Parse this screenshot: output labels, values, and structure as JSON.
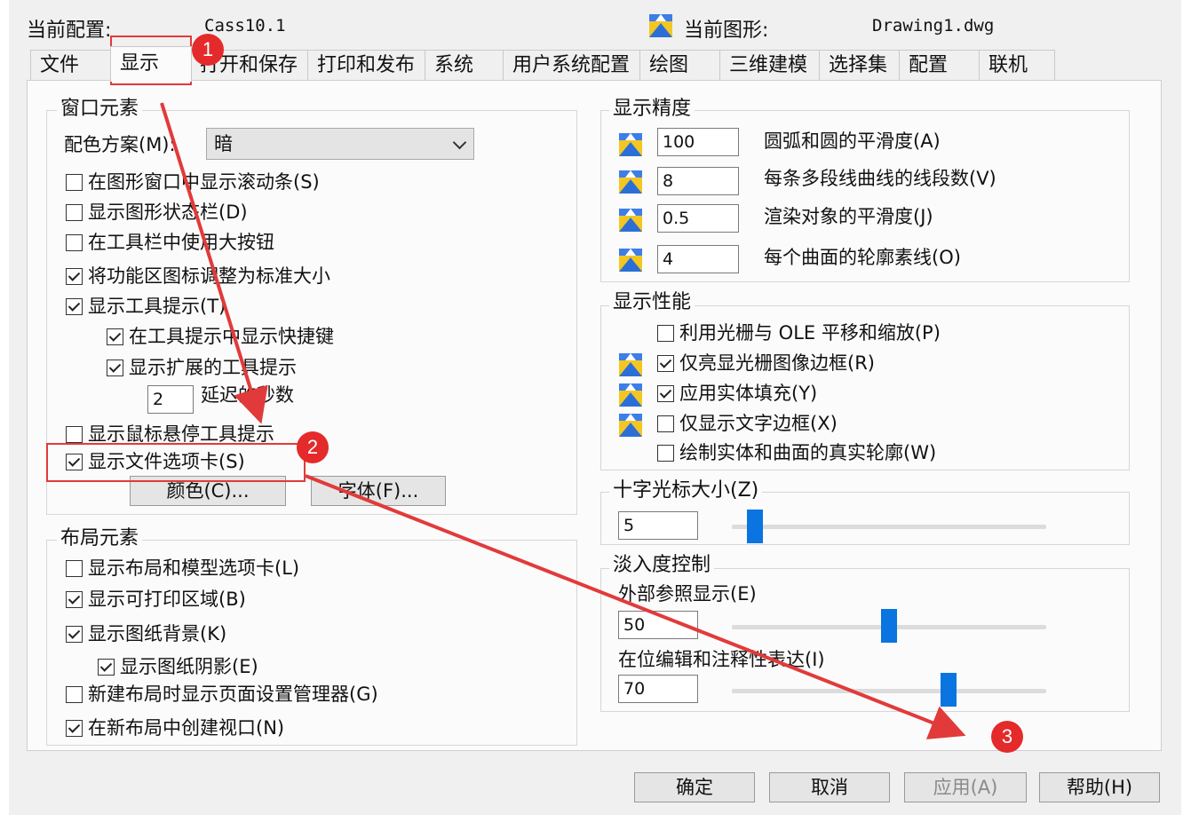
{
  "header": {
    "current_profile_label": "当前配置:",
    "current_profile_value": "Cass10.1",
    "current_drawing_label": "当前图形:",
    "current_drawing_value": "Drawing1.dwg"
  },
  "tabs": [
    {
      "label": "文件"
    },
    {
      "label": "显示",
      "active": true
    },
    {
      "label": "打开和保存"
    },
    {
      "label": "打印和发布"
    },
    {
      "label": "系统"
    },
    {
      "label": "用户系统配置"
    },
    {
      "label": "绘图"
    },
    {
      "label": "三维建模"
    },
    {
      "label": "选择集"
    },
    {
      "label": "配置"
    },
    {
      "label": "联机"
    }
  ],
  "window_elements": {
    "title": "窗口元素",
    "color_scheme_label": "配色方案(M):",
    "color_scheme_value": "暗",
    "checkboxes": [
      {
        "label": "在图形窗口中显示滚动条(S)",
        "checked": false
      },
      {
        "label": "显示图形状态栏(D)",
        "checked": false
      },
      {
        "label": "在工具栏中使用大按钮",
        "checked": false
      },
      {
        "label": "将功能区图标调整为标准大小",
        "checked": true
      },
      {
        "label": "显示工具提示(T)",
        "checked": true
      },
      {
        "label": "在工具提示中显示快捷键",
        "checked": true
      },
      {
        "label": "显示扩展的工具提示",
        "checked": true
      },
      {
        "label": "显示鼠标悬停工具提示",
        "checked": false
      },
      {
        "label": "显示文件选项卡(S)",
        "checked": true
      }
    ],
    "delay_value": "2",
    "delay_label": "延迟的秒数",
    "colors_button": "颜色(C)...",
    "fonts_button": "字体(F)..."
  },
  "layout_elements": {
    "title": "布局元素",
    "checkboxes": [
      {
        "label": "显示布局和模型选项卡(L)",
        "checked": false
      },
      {
        "label": "显示可打印区域(B)",
        "checked": true
      },
      {
        "label": "显示图纸背景(K)",
        "checked": true
      },
      {
        "label": "显示图纸阴影(E)",
        "checked": true
      },
      {
        "label": "新建布局时显示页面设置管理器(G)",
        "checked": false
      },
      {
        "label": "在新布局中创建视口(N)",
        "checked": true
      }
    ]
  },
  "display_resolution": {
    "title": "显示精度",
    "rows": [
      {
        "value": "100",
        "label": "圆弧和圆的平滑度(A)"
      },
      {
        "value": "8",
        "label": "每条多段线曲线的线段数(V)"
      },
      {
        "value": "0.5",
        "label": "渲染对象的平滑度(J)"
      },
      {
        "value": "4",
        "label": "每个曲面的轮廓素线(O)"
      }
    ]
  },
  "display_performance": {
    "title": "显示性能",
    "checkboxes": [
      {
        "label": "利用光栅与 OLE 平移和缩放(P)",
        "checked": false
      },
      {
        "label": "仅亮显光栅图像边框(R)",
        "checked": true
      },
      {
        "label": "应用实体填充(Y)",
        "checked": true
      },
      {
        "label": "仅显示文字边框(X)",
        "checked": false
      },
      {
        "label": "绘制实体和曲面的真实轮廓(W)",
        "checked": false
      }
    ]
  },
  "crosshair": {
    "title": "十字光标大小(Z)",
    "value": "5",
    "level_percent": 5
  },
  "fade_control": {
    "title": "淡入度控制",
    "xref_label": "外部参照显示(E)",
    "xref_value": "50",
    "xref_level_percent": 50,
    "inplace_label": "在位编辑和注释性表达(I)",
    "inplace_value": "70",
    "inplace_level_percent": 70
  },
  "footer": {
    "ok": "确定",
    "cancel": "取消",
    "apply": "应用(A)",
    "help": "帮助(H)"
  },
  "annotations": {
    "badge1": "1",
    "badge2": "2",
    "badge3": "3",
    "color": "#e23a3a"
  }
}
